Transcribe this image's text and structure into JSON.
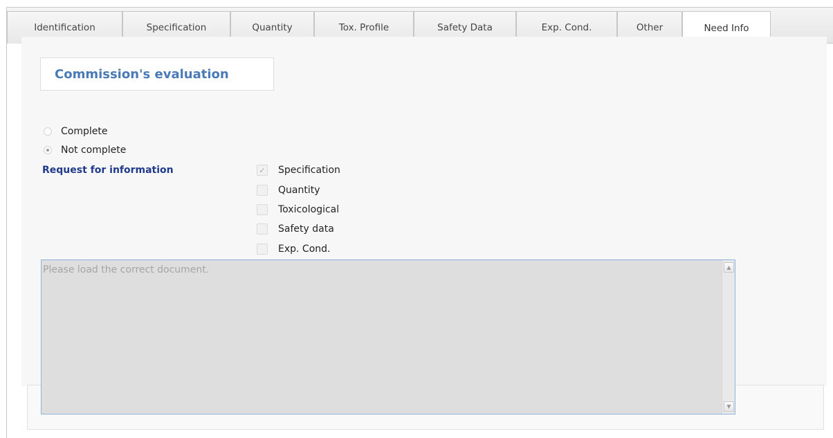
{
  "tabs": [
    {
      "label": "Identification"
    },
    {
      "label": "Specification"
    },
    {
      "label": "Quantity"
    },
    {
      "label": "Tox. Profile"
    },
    {
      "label": "Safety Data"
    },
    {
      "label": "Exp. Cond."
    },
    {
      "label": "Other"
    },
    {
      "label": "Need Info",
      "active": true
    }
  ],
  "heading": "Commission's evaluation",
  "completeness": {
    "options": [
      {
        "label": "Complete",
        "selected": false
      },
      {
        "label": "Not complete",
        "selected": true
      }
    ]
  },
  "request": {
    "label": "Request for information",
    "items": [
      {
        "label": "Specification",
        "checked": true
      },
      {
        "label": "Quantity",
        "checked": false
      },
      {
        "label": "Toxicological",
        "checked": false
      },
      {
        "label": "Safety data",
        "checked": false
      },
      {
        "label": "Exp. Cond.",
        "checked": false
      }
    ]
  },
  "comment": {
    "value": "Please load the correct document."
  },
  "icons": {
    "check": "✓",
    "scroll_up": "▲",
    "scroll_down": "▼"
  }
}
